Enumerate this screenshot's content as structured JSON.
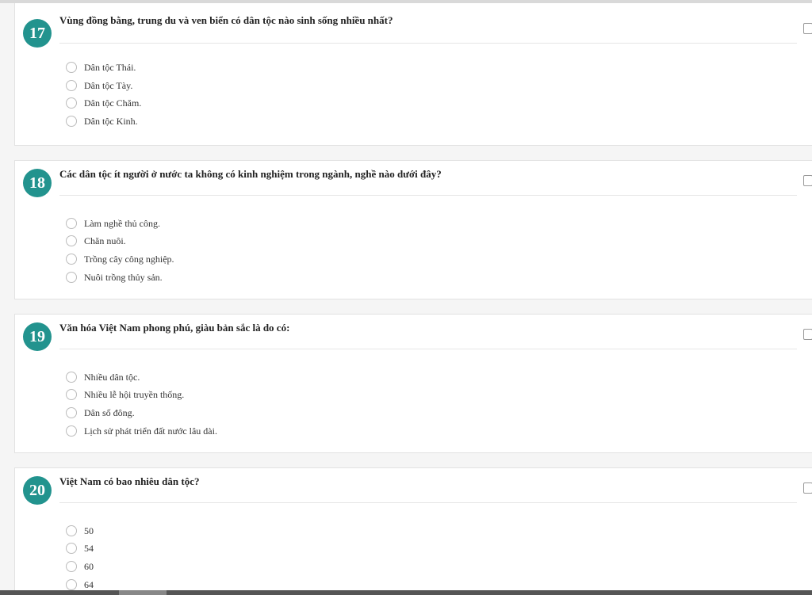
{
  "questions": [
    {
      "number": "17",
      "text": "Vùng đồng bằng, trung du và ven biển có dân tộc nào sinh sống nhiều nhất?",
      "options": [
        "Dân tộc Thái.",
        "Dân tộc Tày.",
        "Dân tộc Chăm.",
        "Dân tộc Kinh."
      ]
    },
    {
      "number": "18",
      "text": "Các dân tộc ít người ở nước ta không có kinh nghiệm trong ngành, nghề nào dưới đây?",
      "options": [
        "Làm nghề thủ công.",
        "Chăn nuôi.",
        "Trồng cây công nghiệp.",
        "Nuôi trồng thủy sản."
      ]
    },
    {
      "number": "19",
      "text": "Văn hóa Việt Nam phong phú, giàu bản sắc là do có:",
      "options": [
        "Nhiều dân tộc.",
        "Nhiều lễ hội truyền thống.",
        "Dân số đông.",
        "Lịch sử phát triển đất nước lâu dài."
      ]
    },
    {
      "number": "20",
      "text": "Việt Nam có bao nhiêu dân tộc?",
      "options": [
        "50",
        "54",
        "60",
        "64"
      ]
    }
  ],
  "colors": {
    "number_badge": "#22938e",
    "card_background": "#ffffff",
    "page_background": "#f5f5f5"
  },
  "icons": {
    "option_marker": "radio-icon",
    "question_flag": "flag-checkbox-icon"
  }
}
